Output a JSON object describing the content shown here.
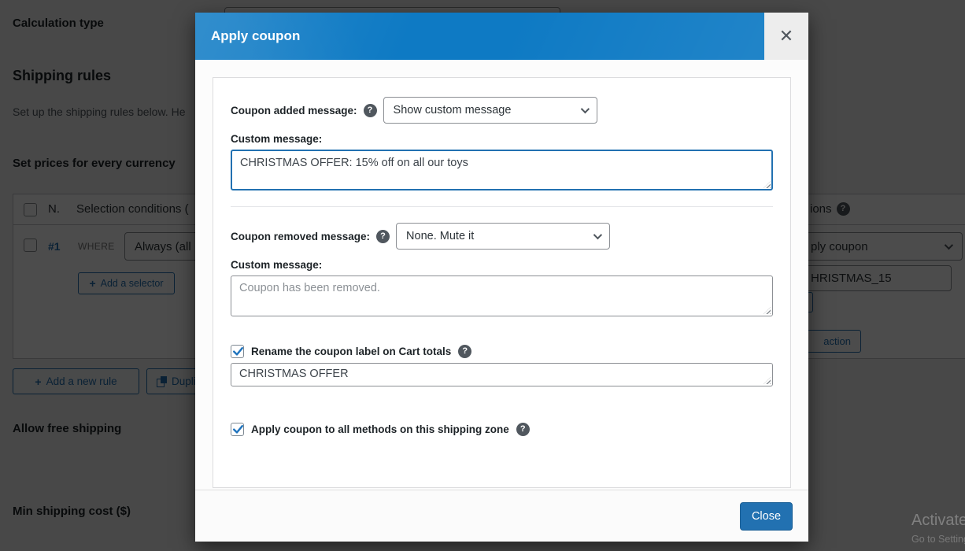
{
  "colors": {
    "modal_header_blue": "#0e7ac4",
    "accent_blue": "#2271b1",
    "focus_border": "#2271b1",
    "help_icon_bg": "#50575e",
    "overlay": "rgba(0,0,0,0.70)"
  },
  "icons": {
    "help": "?",
    "plus": "+",
    "close_x": "✕"
  },
  "page": {
    "headings": {
      "calculation_type": "Calculation type",
      "shipping_rules": "Shipping rules",
      "shipping_rules_desc": "Set up the shipping rules below. He",
      "set_prices": "Set prices for every currency",
      "allow_free_shipping": "Allow free shipping",
      "min_shipping_cost": "Min shipping cost ($)"
    },
    "table": {
      "col_number": "N.",
      "col_conditions": "Selection conditions (",
      "col_actions_fragment": "ions",
      "row_number": "#1",
      "where_label": "WHERE",
      "condition_select_value": "Always (all ",
      "add_selector_label": "Add a selector",
      "action_select_fragment": "ply coupon",
      "coupon_code_fragment": "HRISTMAS_15",
      "action_button_fragment": "action"
    },
    "buttons": {
      "add_new_rule": "Add a new rule",
      "duplicate_fragment": "Dupli"
    },
    "watermark": {
      "line1": "Activate Windows",
      "line2": "Go to Settings to activate Windows."
    }
  },
  "modal": {
    "title": "Apply coupon",
    "fields": {
      "added": {
        "label": "Coupon added message:",
        "select_value": "Show custom message"
      },
      "added_custom": {
        "label": "Custom message:",
        "value": "CHRISTMAS OFFER: 15% off on all our toys"
      },
      "removed": {
        "label": "Coupon removed message:",
        "select_value": "None. Mute it"
      },
      "removed_custom": {
        "label": "Custom message:",
        "placeholder": "Coupon has been removed."
      },
      "rename": {
        "label": "Rename the coupon label on Cart totals",
        "value": "CHRISTMAS OFFER"
      },
      "apply_all": {
        "label": "Apply coupon to all methods on this shipping zone"
      }
    },
    "footer": {
      "close_label": "Close"
    }
  }
}
